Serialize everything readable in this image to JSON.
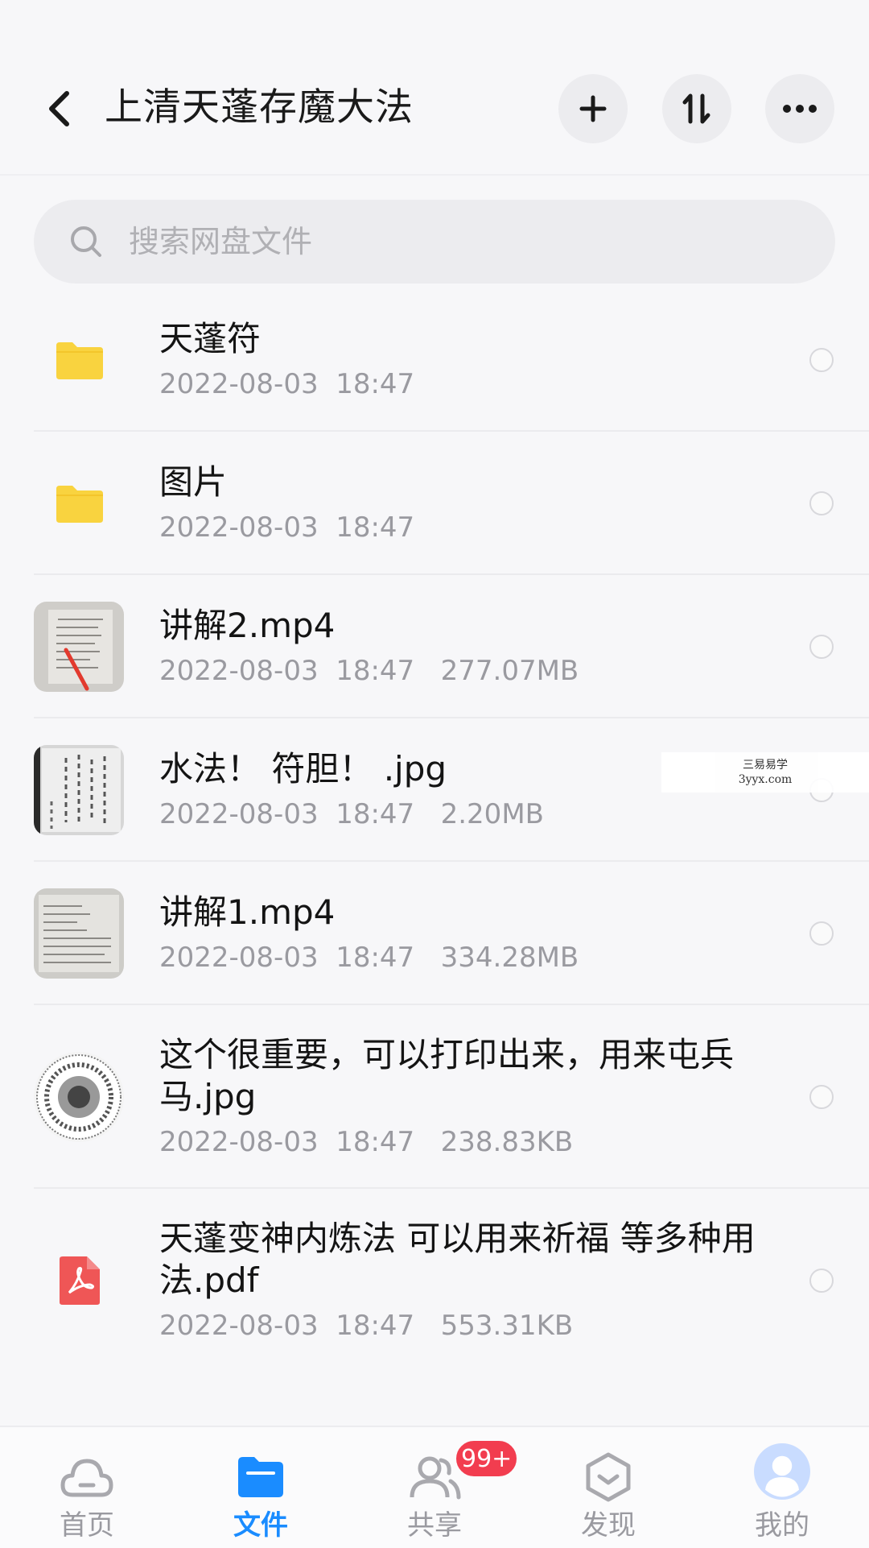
{
  "header": {
    "title": "上清天蓬存魔大法",
    "back_icon": "chevron-left-icon",
    "buttons": [
      "plus-icon",
      "sort-icon",
      "more-icon"
    ]
  },
  "search": {
    "placeholder": "搜索网盘文件"
  },
  "files": [
    {
      "name": "天蓬符",
      "meta": "2022-08-03  18:47",
      "type": "folder"
    },
    {
      "name": "图片",
      "meta": "2022-08-03  18:47",
      "type": "folder"
    },
    {
      "name": "讲解2.mp4",
      "meta": "2022-08-03  18:47   277.07MB",
      "type": "video"
    },
    {
      "name": "水法！ 符胆！ .jpg",
      "meta": "2022-08-03  18:47   2.20MB",
      "type": "image"
    },
    {
      "name": "讲解1.mp4",
      "meta": "2022-08-03  18:47   334.28MB",
      "type": "video"
    },
    {
      "name": "这个很重要，可以打印出来，用来屯兵马.jpg",
      "meta": "2022-08-03  18:47   238.83KB",
      "type": "image"
    },
    {
      "name": "天蓬变神内炼法 可以用来祈福 等多种用法.pdf",
      "meta": "2022-08-03  18:47   553.31KB",
      "type": "pdf"
    }
  ],
  "watermark": {
    "line1": "三易易学",
    "line2": "3yyx.com"
  },
  "tabbar": {
    "items": [
      {
        "label": "首页",
        "icon": "cloud-icon"
      },
      {
        "label": "文件",
        "icon": "folder-icon"
      },
      {
        "label": "共享",
        "icon": "users-icon"
      },
      {
        "label": "发现",
        "icon": "discover-icon"
      },
      {
        "label": "我的",
        "icon": "avatar-icon"
      }
    ],
    "share_badge": "99+",
    "active_color": "#1a8cff",
    "badge_color": "#f23d4f"
  }
}
